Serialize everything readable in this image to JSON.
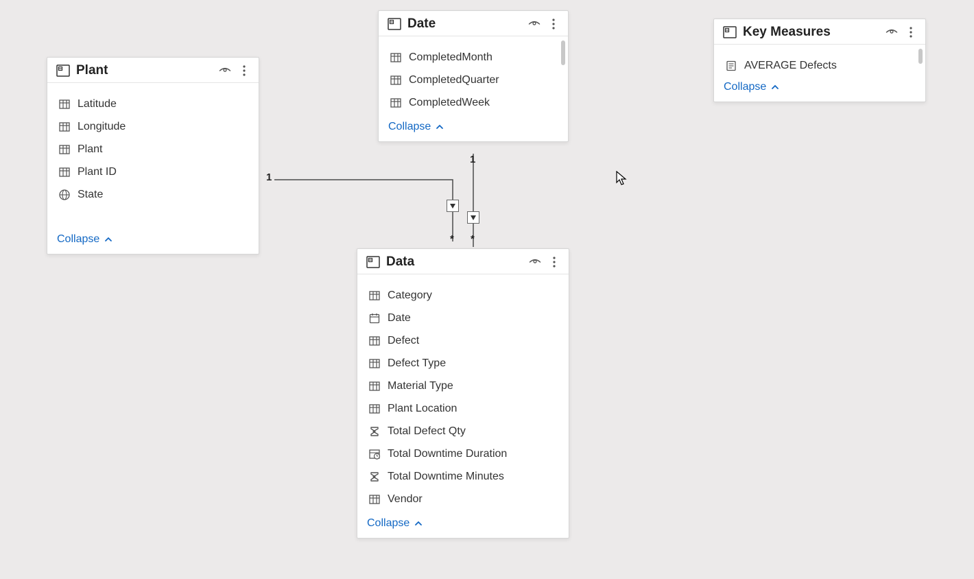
{
  "common": {
    "collapse_label": "Collapse"
  },
  "tables": {
    "plant": {
      "title": "Plant",
      "fields": [
        {
          "icon": "column",
          "label": "Latitude"
        },
        {
          "icon": "column",
          "label": "Longitude"
        },
        {
          "icon": "column",
          "label": "Plant"
        },
        {
          "icon": "column",
          "label": "Plant ID"
        },
        {
          "icon": "globe",
          "label": "State"
        }
      ]
    },
    "date": {
      "title": "Date",
      "fields": [
        {
          "icon": "column",
          "label": "CompletedMonth"
        },
        {
          "icon": "column",
          "label": "CompletedQuarter"
        },
        {
          "icon": "column",
          "label": "CompletedWeek"
        }
      ]
    },
    "data": {
      "title": "Data",
      "fields": [
        {
          "icon": "column",
          "label": "Category"
        },
        {
          "icon": "calendar",
          "label": "Date"
        },
        {
          "icon": "column",
          "label": "Defect"
        },
        {
          "icon": "column",
          "label": "Defect Type"
        },
        {
          "icon": "column",
          "label": "Material Type"
        },
        {
          "icon": "column",
          "label": "Plant Location"
        },
        {
          "icon": "sigma",
          "label": "Total Defect Qty"
        },
        {
          "icon": "duration",
          "label": "Total Downtime Duration"
        },
        {
          "icon": "sigma",
          "label": "Total Downtime Minutes"
        },
        {
          "icon": "column",
          "label": "Vendor"
        }
      ]
    },
    "keymeasures": {
      "title": "Key Measures",
      "fields": [
        {
          "icon": "measure",
          "label": "AVERAGE Defects"
        }
      ]
    }
  },
  "relationships": [
    {
      "from": "plant",
      "to": "data",
      "from_card": "1",
      "to_card": "*"
    },
    {
      "from": "date",
      "to": "data",
      "from_card": "1",
      "to_card": "*"
    }
  ]
}
